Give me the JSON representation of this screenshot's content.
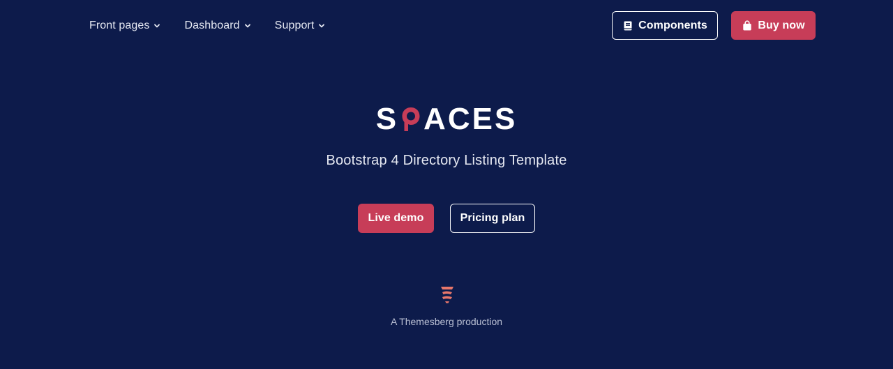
{
  "nav": {
    "links": [
      {
        "label": "Front pages",
        "icon": "chevron-down-icon"
      },
      {
        "label": "Dashboard",
        "icon": "chevron-down-icon"
      },
      {
        "label": "Support",
        "icon": "chevron-down-icon"
      }
    ],
    "components_label": "Components",
    "components_icon": "book-icon",
    "buy_label": "Buy now",
    "buy_icon": "shopping-bag-icon"
  },
  "hero": {
    "logo_left": "S",
    "logo_right": "ACES",
    "logo_full": "SPACES",
    "subtitle": "Bootstrap 4 Directory Listing Template",
    "live_demo_label": "Live demo",
    "pricing_label": "Pricing plan"
  },
  "footer": {
    "credit": "A Themesberg production",
    "brand_icon": "themesberg-logo-icon"
  },
  "colors": {
    "background": "#0d1b4b",
    "accent": "#c73d58",
    "brand_mark": "#e8776a",
    "text": "#ffffff"
  }
}
